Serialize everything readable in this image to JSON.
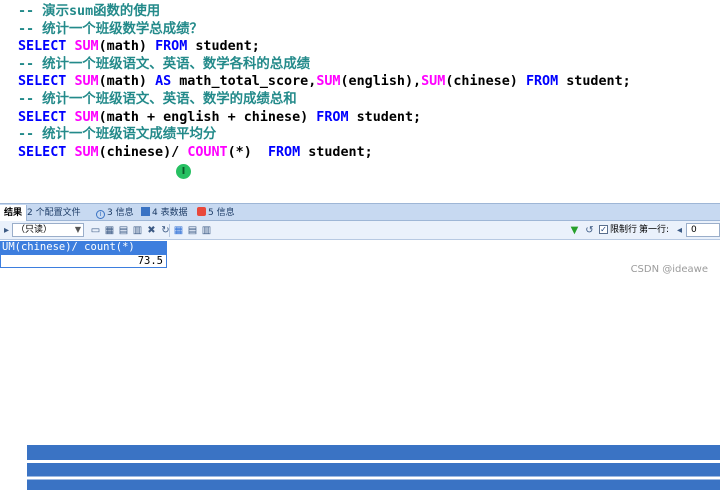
{
  "editor": {
    "lines": [
      [
        {
          "t": "-- 演示sum函数的使用",
          "k": "comment"
        }
      ],
      [
        {
          "t": "-- 统计一个班级数学总成绩？",
          "k": "comment"
        }
      ],
      [
        {
          "t": "SELECT",
          "k": "keyword"
        },
        {
          "t": " ",
          "k": "ident"
        },
        {
          "t": "SUM",
          "k": "function"
        },
        {
          "t": "(math) ",
          "k": "ident"
        },
        {
          "t": "FROM",
          "k": "keyword"
        },
        {
          "t": " student;",
          "k": "ident"
        }
      ],
      [
        {
          "t": "-- 统计一个班级语文、英语、数学各科的总成绩",
          "k": "comment"
        }
      ],
      [
        {
          "t": "SELECT",
          "k": "keyword"
        },
        {
          "t": " ",
          "k": "ident"
        },
        {
          "t": "SUM",
          "k": "function"
        },
        {
          "t": "(math) ",
          "k": "ident"
        },
        {
          "t": "AS",
          "k": "keyword"
        },
        {
          "t": " math_total_score,",
          "k": "ident"
        },
        {
          "t": "SUM",
          "k": "function"
        },
        {
          "t": "(english),",
          "k": "ident"
        },
        {
          "t": "SUM",
          "k": "function"
        },
        {
          "t": "(chinese) ",
          "k": "ident"
        },
        {
          "t": "FROM",
          "k": "keyword"
        },
        {
          "t": " student;",
          "k": "ident"
        }
      ],
      [
        {
          "t": "-- 统计一个班级语文、英语、数学的成绩总和",
          "k": "comment"
        }
      ],
      [
        {
          "t": "SELECT",
          "k": "keyword"
        },
        {
          "t": " ",
          "k": "ident"
        },
        {
          "t": "SUM",
          "k": "function"
        },
        {
          "t": "(math + english + chinese) ",
          "k": "ident"
        },
        {
          "t": "FROM",
          "k": "keyword"
        },
        {
          "t": " student;",
          "k": "ident"
        }
      ],
      [
        {
          "t": "-- 统计一个班级语文成绩平均分",
          "k": "comment"
        }
      ],
      [
        {
          "t": "SELECT",
          "k": "keyword"
        },
        {
          "t": " ",
          "k": "ident"
        },
        {
          "t": "SUM",
          "k": "function"
        },
        {
          "t": "(chinese)/ ",
          "k": "ident"
        },
        {
          "t": "COUNT",
          "k": "function"
        },
        {
          "t": "(*)  ",
          "k": "ident"
        },
        {
          "t": "FROM",
          "k": "keyword"
        },
        {
          "t": " student;",
          "k": "ident"
        }
      ]
    ],
    "cursor_glyph": "I"
  },
  "tabs": [
    {
      "label": "结果",
      "icon": "",
      "active": true
    },
    {
      "label": "2 个配置文件",
      "icon": "grid-icon",
      "active": false
    },
    {
      "label": "3 信息",
      "icon": "info-icon",
      "active": false
    },
    {
      "label": "4 表数据",
      "icon": "table-icon",
      "active": false
    },
    {
      "label": "5 信息",
      "icon": "message-icon",
      "active": false
    }
  ],
  "toolbar": {
    "mode_value": "（只读）",
    "limit_rows_label": "限制行",
    "first_row_label": "第一行:",
    "first_row_value": "0"
  },
  "result": {
    "header": "UM(chinese)/ count(*)",
    "value": "73.5"
  },
  "watermark": "CSDN @ideawe",
  "colors": {
    "comment": "#238a8a",
    "keyword": "#0000ff",
    "function": "#ff00ff",
    "header_bg": "#3d7ede",
    "tab_bar": "#c7d9f1"
  }
}
